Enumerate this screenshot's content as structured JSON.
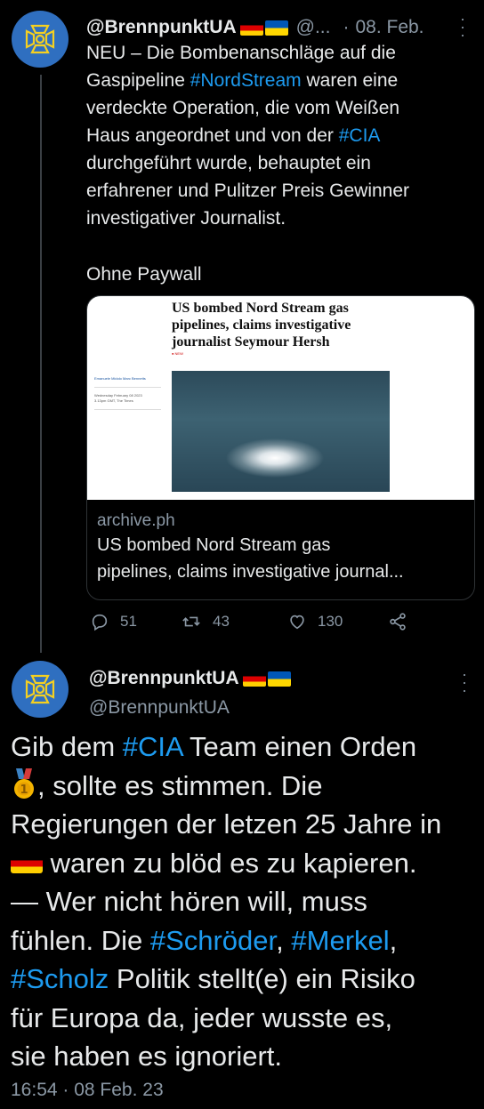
{
  "tweet1": {
    "handle_display": "@BrennpunktUA",
    "handle_muted": "@...",
    "separator": "·",
    "date": "08. Feb.",
    "text_lines": [
      "NEU – Die Bombenanschläge auf die",
      "Gaspipeline ",
      "#NordStream",
      " waren eine",
      "verdeckte Operation, die vom Weißen",
      "Haus angeordnet und von der ",
      "#CIA",
      "durchgeführt wurde, behauptet ein",
      "erfahrener und Pulitzer Preis Gewinner",
      "investigativer Journalist.",
      "Ohne Paywall"
    ],
    "card": {
      "headline_1": "US bombed Nord Stream gas",
      "headline_2": "pipelines, claims investigative",
      "headline_3": "journalist Seymour Hersh",
      "new_label": "● NEW",
      "side_author": "Emanuele Midolo  Marc Bennetts",
      "side_date_1": "Wednesday February 08 2023",
      "side_date_2": "3.13pm GMT, The Times",
      "domain": "archive.ph",
      "title_line_1": "US bombed Nord Stream gas",
      "title_line_2": "pipelines, claims investigative journal..."
    },
    "actions": {
      "replies": "51",
      "retweets": "43",
      "likes": "130"
    }
  },
  "tweet2": {
    "name": "@BrennpunktUA",
    "handle": "@BrennpunktUA",
    "body": {
      "l1a": "Gib dem ",
      "l1_tag": "#CIA",
      "l1b": " Team einen Orden",
      "l2": ", sollte es stimmen. Die",
      "l3": "Regierungen der letzen 25 Jahre in",
      "l4": " waren zu blöd es zu kapieren.",
      "l5": "— Wer nicht hören will, muss",
      "l6a": "fühlen. Die ",
      "l6_tag1": "#Schröder",
      "l6b": ", ",
      "l6_tag2": "#Merkel",
      "l6c": ",",
      "l7_tag": "#Scholz",
      "l7b": " Politik stellt(e) ein Risiko",
      "l8": "für Europa da, jeder wusste es,",
      "l9": "sie haben es ignoriert."
    },
    "timestamp": "16:54 · 08 Feb. 23"
  },
  "icons": [
    "more-icon",
    "reply-icon",
    "retweet-icon",
    "like-icon",
    "share-icon",
    "medal-emoji",
    "de-flag",
    "ua-flag",
    "avatar-emblem"
  ],
  "colors": {
    "background": "#000000",
    "text": "#e7e9ea",
    "muted": "#8b98a5",
    "link": "#1d9bf0",
    "avatar": "#2f6fc0"
  }
}
